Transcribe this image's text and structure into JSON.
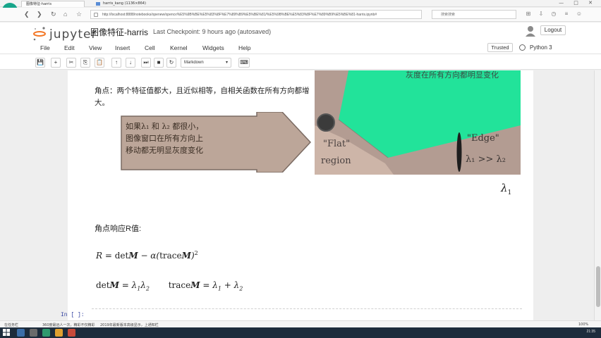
{
  "browser": {
    "tab_active": "图像特征-harris",
    "tab_second": "harris_kang (1136×864)",
    "address": "http://localhost:8888/notebooks/openew/opencv%E5%9B%BE%E5%83%8F%E7%89%B9%E5%BE%81/%E5%9B%BE%E5%83%8F%E7%89%B9%E5%BE%81-harris.ipynb#",
    "search_placeholder": "搜索搜索",
    "window_controls": "— □ ✕"
  },
  "jupyter": {
    "logo_text": "jupyter",
    "notebook_title": "图像特征-harris",
    "checkpoint": "Last Checkpoint: 9 hours ago (autosaved)",
    "logout_label": "Logout",
    "trusted_label": "Trusted",
    "kernel_label": "Python 3"
  },
  "menu": {
    "items": [
      "File",
      "Edit",
      "View",
      "Insert",
      "Cell",
      "Kernel",
      "Widgets",
      "Help"
    ]
  },
  "toolbar": {
    "buttons": [
      "💾",
      "+",
      "✂",
      "⎘",
      "📋",
      "↑",
      "↓",
      "⏭",
      "■",
      "↻"
    ],
    "cell_type": "Markdown",
    "keyboard_icon": "⌨"
  },
  "content": {
    "corner_text": "角点：两个特征值都大，且近似相等，自相关函数在所有方向都增大。",
    "callout_line1": "如果λ₁ 和 λ₂ 都很小，",
    "callout_line2": "图像窗口在所有方向上",
    "callout_line3": "移动都无明显灰度变化",
    "figure_top_text": "灰度在所有方向都明显变化",
    "flat_label_1": "\"Flat\"",
    "flat_label_2": "region",
    "edge_label_1": "\"Edge\"",
    "edge_label_2": "λ₁ >> λ₂",
    "lambda_axis": "λ",
    "lambda_sub": "1",
    "r_heading": "角点响应R值:",
    "input_prompt": "In [ ]:"
  },
  "colors": {
    "figure_bg": "#b39c92",
    "corner_region": "#22e39a",
    "flat_region": "#cdb5a8",
    "callout_fill": "#bca699"
  },
  "status": {
    "left": "在任务栏",
    "item2": "360度最远人一次，精彩不仅精彩",
    "item3": "2019年最新版本高级显示，上通知栏",
    "right": "100%"
  },
  "taskbar": {
    "clock": "21:35"
  }
}
